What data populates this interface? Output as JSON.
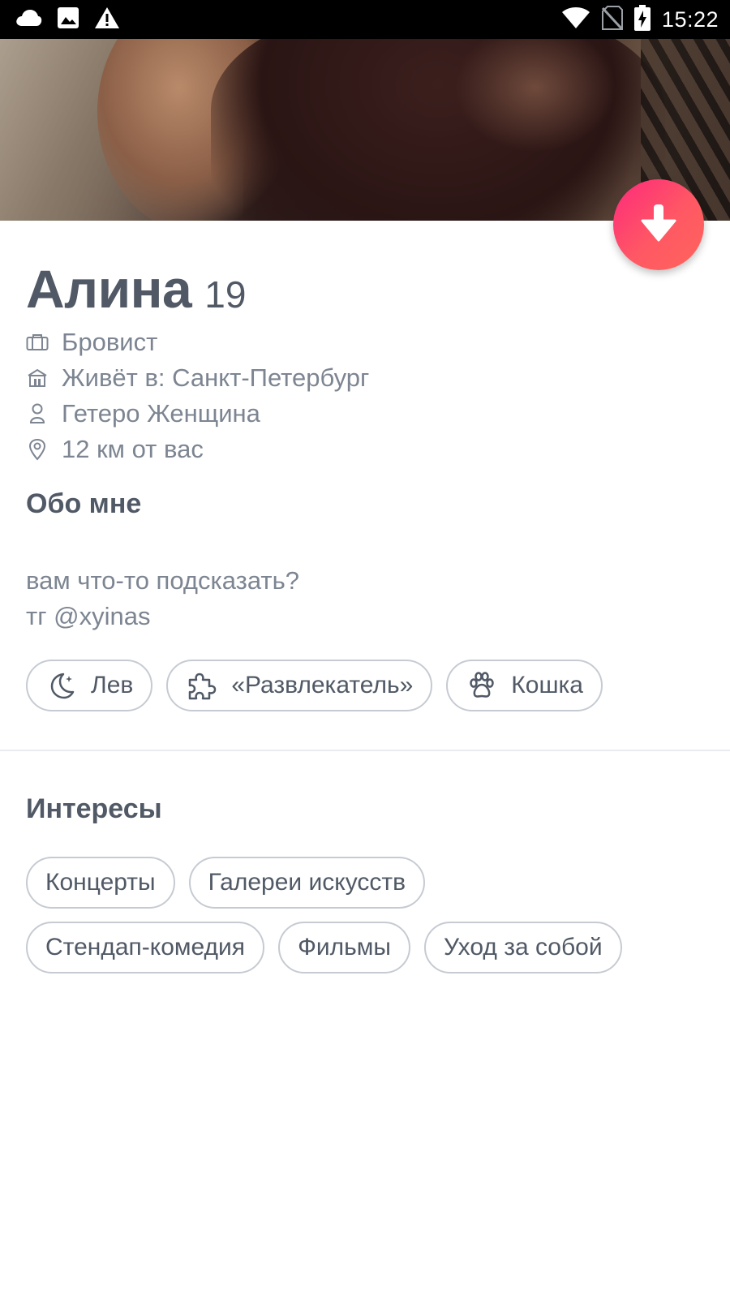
{
  "status_bar": {
    "time": "15:22",
    "left_icons": [
      "cloud-icon",
      "image-icon",
      "warning-icon"
    ],
    "right_icons": [
      "wifi-icon",
      "no-sim-icon",
      "battery-charging-icon"
    ]
  },
  "profile": {
    "name": "Алина",
    "age": "19",
    "details": [
      {
        "icon": "briefcase-icon",
        "text": "Бровист"
      },
      {
        "icon": "home-icon",
        "text": "Живёт в: Санкт-Петербург"
      },
      {
        "icon": "person-icon",
        "text": "Гетеро Женщина"
      },
      {
        "icon": "location-pin-icon",
        "text": "12 км от вас"
      }
    ]
  },
  "about": {
    "title": "Обо мне",
    "lines": [
      "вам что-то подсказать?",
      "тг @xyinas"
    ]
  },
  "attributes": [
    {
      "icon": "moon-icon",
      "label": "Лев"
    },
    {
      "icon": "puzzle-icon",
      "label": "«Развлекатель»"
    },
    {
      "icon": "paw-icon",
      "label": "Кошка"
    }
  ],
  "interests": {
    "title": "Интересы",
    "row1": [
      "Концерты",
      "Галереи искусств"
    ],
    "row2": [
      "Стендап-комедия",
      "Фильмы",
      "Уход за собой"
    ]
  },
  "colors": {
    "accent_gradient_start": "#fd297b",
    "accent_gradient_end": "#ff655b",
    "heading_text": "#505965",
    "secondary_text": "#7c8591",
    "chip_border": "#c6cbd2"
  }
}
